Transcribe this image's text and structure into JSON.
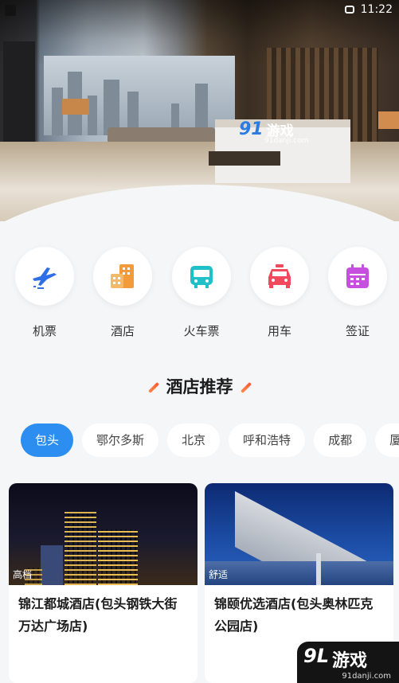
{
  "status": {
    "time": "11:22"
  },
  "hero": {
    "watermark_logo": "91",
    "watermark_text": "游戏",
    "watermark_url": "91danji.com"
  },
  "categories": [
    {
      "label": "机票",
      "icon": "plane-icon",
      "color": "#2e6fe8"
    },
    {
      "label": "酒店",
      "icon": "hotel-icon",
      "color": "#f39a3b"
    },
    {
      "label": "火车票",
      "icon": "train-icon",
      "color": "#1fc0c8"
    },
    {
      "label": "用车",
      "icon": "car-icon",
      "color": "#f2495e"
    },
    {
      "label": "签证",
      "icon": "calendar-icon",
      "color": "#c64fe0"
    }
  ],
  "section": {
    "title": "酒店推荐"
  },
  "cities": [
    "包头",
    "鄂尔多斯",
    "北京",
    "呼和浩特",
    "成都",
    "厦"
  ],
  "hotels": [
    {
      "tag": "高档",
      "name": "锦江都城酒店(包头钢铁大街万达广场店)"
    },
    {
      "tag": "舒适",
      "name": "锦颐优选酒店(包头奥林匹克公园店)"
    }
  ],
  "corner_watermark": {
    "logo": "9L",
    "text": "游戏",
    "url": "91danji.com"
  },
  "colors": {
    "accent": "#2b8ef0",
    "title_slash": "#ff6a3d"
  }
}
